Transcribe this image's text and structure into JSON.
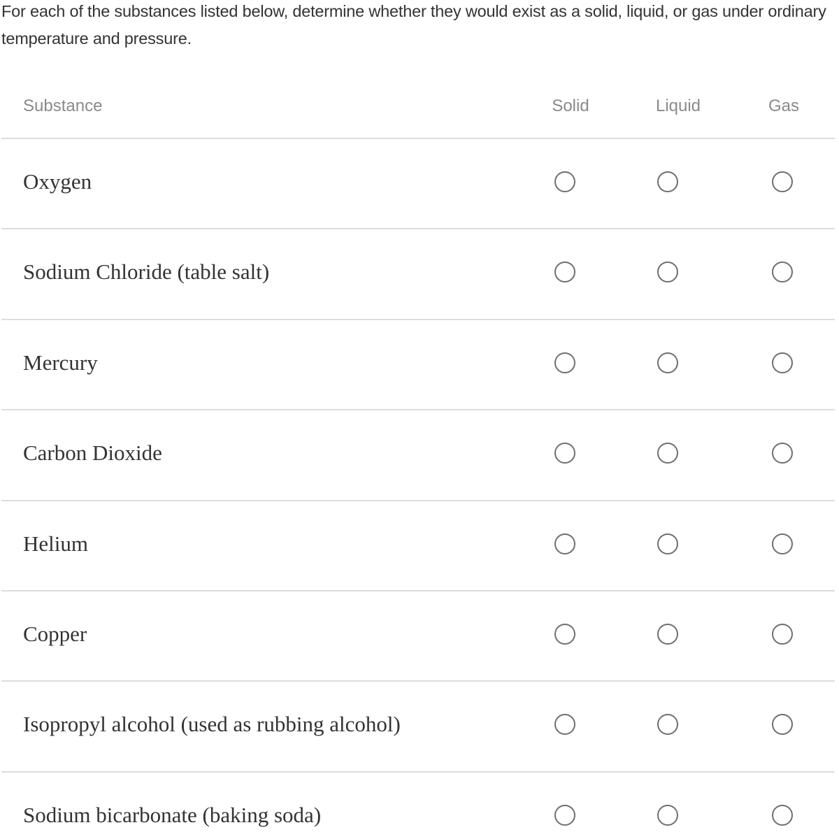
{
  "question": {
    "text": "For each of the substances listed below, determine whether they would exist as a solid, liquid, or gas under ordinary temperature and pressure."
  },
  "table": {
    "row_header": "Substance",
    "columns": [
      "Solid",
      "Liquid",
      "Gas"
    ],
    "rows": [
      {
        "label": "Oxygen",
        "selected": null
      },
      {
        "label": "Sodium Chloride (table salt)",
        "selected": null
      },
      {
        "label": "Mercury",
        "selected": null
      },
      {
        "label": "Carbon Dioxide",
        "selected": null
      },
      {
        "label": "Helium",
        "selected": null
      },
      {
        "label": "Copper",
        "selected": null
      },
      {
        "label": "Isopropyl alcohol (used as rubbing alcohol)",
        "selected": null
      },
      {
        "label": "Sodium bicarbonate (baking soda)",
        "selected": null
      }
    ]
  },
  "icons": {
    "radio": "radio-unchecked-icon"
  }
}
